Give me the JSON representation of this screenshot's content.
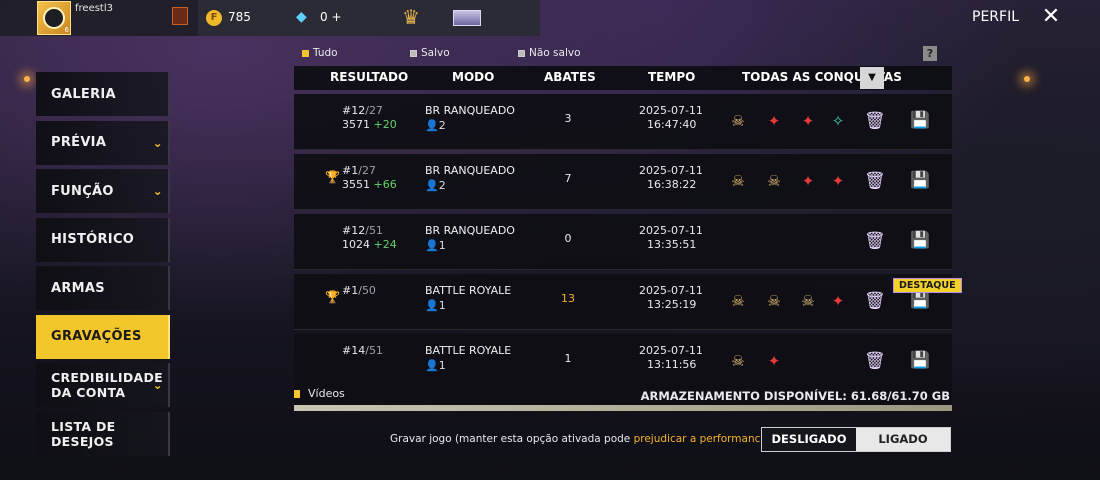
{
  "user": {
    "name": "freestl3",
    "level": "6"
  },
  "currency": {
    "coins": "785",
    "diamonds": "0 +"
  },
  "header": {
    "perfil": "PERFIL"
  },
  "sidebar": {
    "items": [
      {
        "label": "GALERIA",
        "chevron": false,
        "active": false
      },
      {
        "label": "PRÉVIA",
        "chevron": true,
        "active": false
      },
      {
        "label": "FUNÇÃO",
        "chevron": true,
        "active": false
      },
      {
        "label": "HISTÓRICO",
        "chevron": false,
        "active": false
      },
      {
        "label": "ARMAS",
        "chevron": false,
        "active": false
      },
      {
        "label": "GRAVAÇÕES",
        "chevron": false,
        "active": true
      },
      {
        "label_line1": "CREDIBILIDADE",
        "label_line2": "DA CONTA",
        "chevron": true,
        "active": false
      },
      {
        "label_line1": "LISTA DE",
        "label_line2": "DESEJOS",
        "chevron": false,
        "active": false
      }
    ]
  },
  "filters": [
    {
      "label": "Tudo",
      "selected": true
    },
    {
      "label": "Salvo",
      "selected": false
    },
    {
      "label": "Não salvo",
      "selected": false
    }
  ],
  "help": "?",
  "table": {
    "headers": {
      "resultado": "RESULTADO",
      "modo": "MODO",
      "abates": "ABATES",
      "tempo": "TEMPO",
      "conquistas": "TODAS AS CONQUISTAS"
    },
    "rows": [
      {
        "rank": "#12",
        "total": "27",
        "points": "3571",
        "gain": "+20",
        "trophy": false,
        "mode": "BR RANQUEADO",
        "players": "2",
        "kills": "3",
        "kills_highlight": false,
        "date": "2025-07-11",
        "time": "16:47:40",
        "achievements": [
          "gold",
          "red",
          "red",
          "teal"
        ],
        "destaque": false
      },
      {
        "rank": "#1",
        "total": "27",
        "points": "3551",
        "gain": "+66",
        "trophy": true,
        "mode": "BR RANQUEADO",
        "players": "2",
        "kills": "7",
        "kills_highlight": false,
        "date": "2025-07-11",
        "time": "16:38:22",
        "achievements": [
          "gold",
          "gold",
          "red",
          "red"
        ],
        "destaque": false
      },
      {
        "rank": "#12",
        "total": "51",
        "points": "1024",
        "gain": "+24",
        "trophy": false,
        "mode": "BR RANQUEADO",
        "players": "1",
        "kills": "0",
        "kills_highlight": false,
        "date": "2025-07-11",
        "time": "13:35:51",
        "achievements": [],
        "destaque": false
      },
      {
        "rank": "#1",
        "total": "50",
        "points": "",
        "gain": "",
        "trophy": true,
        "mode": "BATTLE ROYALE",
        "players": "1",
        "kills": "13",
        "kills_highlight": true,
        "date": "2025-07-11",
        "time": "13:25:19",
        "achievements": [
          "gold",
          "gold",
          "gold",
          "red"
        ],
        "destaque": true
      },
      {
        "rank": "#14",
        "total": "51",
        "points": "",
        "gain": "",
        "trophy": false,
        "mode": "BATTLE ROYALE",
        "players": "1",
        "kills": "1",
        "kills_highlight": false,
        "date": "2025-07-11",
        "time": "13:11:56",
        "achievements": [
          "gold",
          "red"
        ],
        "destaque": false
      }
    ],
    "destaque_label": "DESTAQUE"
  },
  "storage": {
    "videos_label": "Vídeos",
    "text": "ARMAZENAMENTO DISPONÍVEL: 61.68/61.70 GB",
    "used_fraction": 1.0
  },
  "record": {
    "text_before": "Gravar jogo (manter esta opção ativada pode ",
    "text_warning": "prejudicar a performance de jogo",
    "text_after": ").",
    "off_label": "DESLIGADO",
    "on_label": "LIGADO"
  },
  "colors": {
    "accent": "#f3c62b",
    "gain": "#66d16a",
    "warning": "#f3b32a"
  }
}
